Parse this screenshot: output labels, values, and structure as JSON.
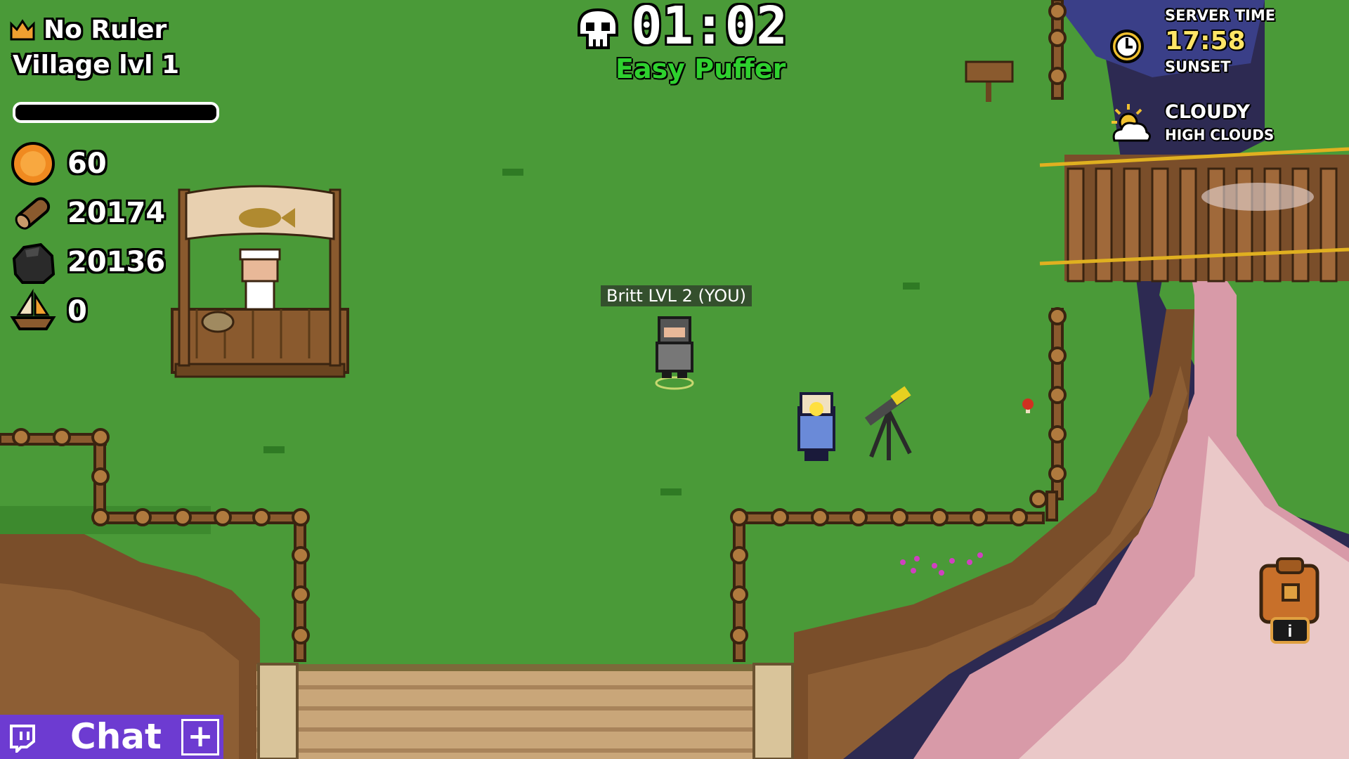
{
  "hud": {
    "ruler": "No Ruler",
    "village_level": "Village lvl 1",
    "village_progress": 0,
    "resources": [
      {
        "name": "coin-icon",
        "value": "60"
      },
      {
        "name": "wood-icon",
        "value": "20174"
      },
      {
        "name": "stone-icon",
        "value": "20136"
      },
      {
        "name": "boat-icon",
        "value": "0"
      }
    ]
  },
  "timer": {
    "value": "01:02",
    "difficulty": "Easy Puffer",
    "icon": "skull-icon"
  },
  "server": {
    "label": "SERVER TIME",
    "time": "17:58",
    "period": "SUNSET",
    "weather": "CLOUDY",
    "weather_detail": "HIGH CLOUDS",
    "clock_icon": "clock-icon",
    "weather_icon": "cloudy-sun-icon"
  },
  "player": {
    "tag": "Britt LVL 2 (YOU)"
  },
  "chat": {
    "label": "Chat",
    "plus": "+",
    "icon": "twitch-icon"
  },
  "colors": {
    "grass": "#4a9a38",
    "grass_dark": "#3d8a2e",
    "difficulty": "#2ed12e",
    "time_yellow": "#ffe566",
    "chat_purple": "#6d3bd1",
    "wood": "#8a5a2e",
    "cliff": "#7a4e2a",
    "sky_pink": "#e8b0b8"
  }
}
